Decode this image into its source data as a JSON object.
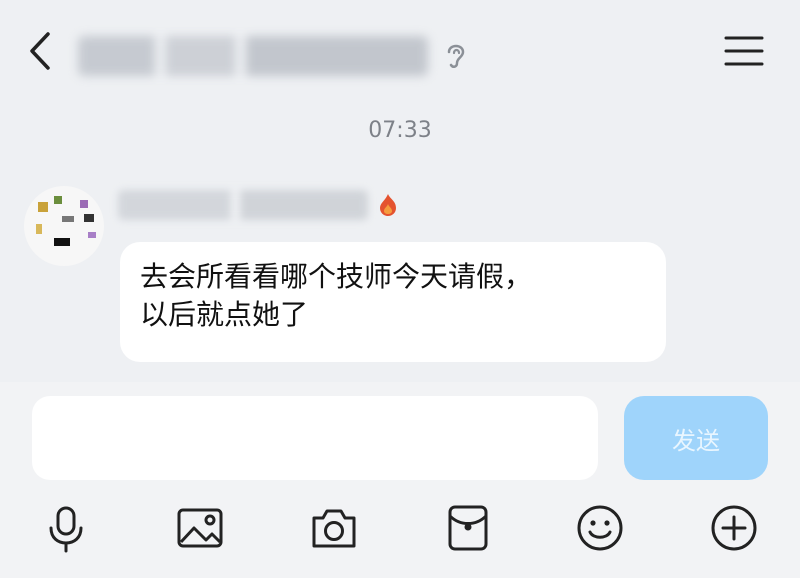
{
  "header": {
    "back_icon": "chevron-left-icon",
    "title": "",
    "title_icon": "ear-icon",
    "menu_icon": "menu-icon"
  },
  "chat": {
    "timestamp": "07:33",
    "messages": [
      {
        "sender": "",
        "badge_icon": "flame-badge-icon",
        "text": "去会所看看哪个技师今天请假，\n以后就点她了"
      }
    ]
  },
  "composer": {
    "input_value": "",
    "input_placeholder": "",
    "send_label": "发送"
  },
  "toolbar": {
    "items": [
      "microphone-icon",
      "image-icon",
      "camera-icon",
      "red-packet-icon",
      "emoji-icon",
      "plus-icon"
    ]
  },
  "colors": {
    "background": "#eef0f3",
    "bubble": "#ffffff",
    "send_button": "#9fd4fb",
    "timestamp": "#7d8188",
    "icon": "#222222"
  }
}
